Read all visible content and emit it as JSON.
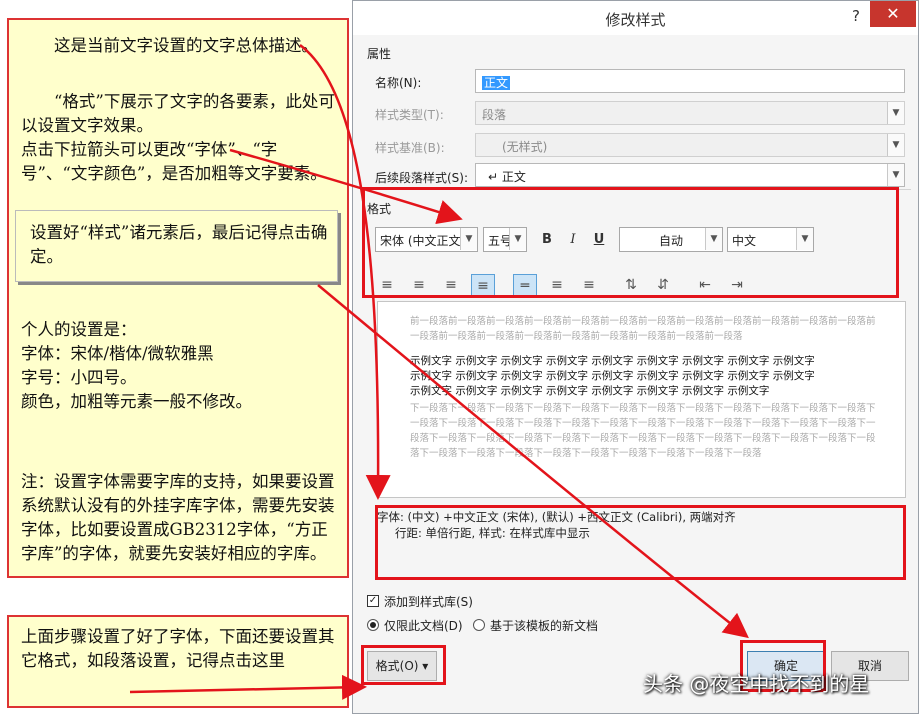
{
  "dialog": {
    "title": "修改样式",
    "help": "?",
    "close": "✕",
    "properties_label": "属性",
    "name_label": "名称(N):",
    "name_value": "正文",
    "style_type_label": "样式类型(T):",
    "style_type_value": "段落",
    "based_on_label": "样式基准(B):",
    "based_on_value": "(无样式)",
    "next_style_label": "后续段落样式(S):",
    "next_style_value": "↵ 正文",
    "format_label": "格式",
    "font": "宋体 (中文正文)",
    "size": "五号",
    "bold": "B",
    "italic": "I",
    "underline": "U",
    "color": "自动",
    "script": "中文",
    "preview": {
      "prev_para": "前一段落前一段落前一段落前一段落前一段落前一段落前一段落前一段落前一段落前一段落前一段落前一段落前一段落前一段落前一段落前一段落前一段落前一段落前一段落前一段落前一段落",
      "sample_lines": [
        "示例文字 示例文字 示例文字 示例文字 示例文字 示例文字 示例文字 示例文字 示例文字",
        "示例文字 示例文字 示例文字 示例文字 示例文字 示例文字 示例文字 示例文字 示例文字",
        "示例文字 示例文字 示例文字 示例文字 示例文字 示例文字 示例文字 示例文字"
      ],
      "next_para": "下一段落下一段落下一段落下一段落下一段落下一段落下一段落下一段落下一段落下一段落下一段落下一段落下一段落下一段落下一段落下一段落下一段落下一段落下一段落下一段落下一段落下一段落下一段落下一段落下一段落下一段落下一段落下一段落下一段落下一段落下一段落下一段落下一段落下一段落下一段落下一段落下一段落下一段落下一段落下一段落下一段落下一段落下一段落下一段落下一段落下一段落"
    },
    "description_line1": "字体: (中文) +中文正文 (宋体), (默认) +西文正文 (Calibri), 两端对齐",
    "description_line2": "行距: 单倍行距, 样式: 在样式库中显示",
    "add_to_gallery": "添加到样式库(S)",
    "only_this_doc": "仅限此文档(D)",
    "new_docs_template": "基于该模板的新文档",
    "format_button": "格式(O) ▾",
    "ok": "确定",
    "cancel": "取消"
  },
  "notes": {
    "p1": "这是当前文字设置的文字总体描述。",
    "p2": "“格式”下展示了文字的各要素，此处可以设置文字效果。",
    "p3": "点击下拉箭头可以更改“字体”、“字号”、“文字颜色”，是否加粗等文字要素。",
    "callout": "设置好“样式”诸元素后，最后记得点击确定。",
    "personal_title": "个人的设置是：",
    "personal_font": "字体：宋体/楷体/微软雅黑",
    "personal_size": "字号：小四号。",
    "personal_color": "颜色，加粗等元素一般不修改。",
    "note": "注：设置字体需要字库的支持，如果要设置系统默认没有的外挂字库字体，需要先安装字体，比如要设置成GB2312字体，“方正字库”的字体，就要先安装好相应的字库。",
    "bottom": "上面步骤设置了好了字体，下面还要设置其它格式，如段落设置，记得点击这里"
  },
  "watermark": "头条 @夜空中找不到的星",
  "colors": {
    "annotation_red": "#e3141b",
    "note_bg": "#ffffcc",
    "close_red": "#c7352d"
  }
}
